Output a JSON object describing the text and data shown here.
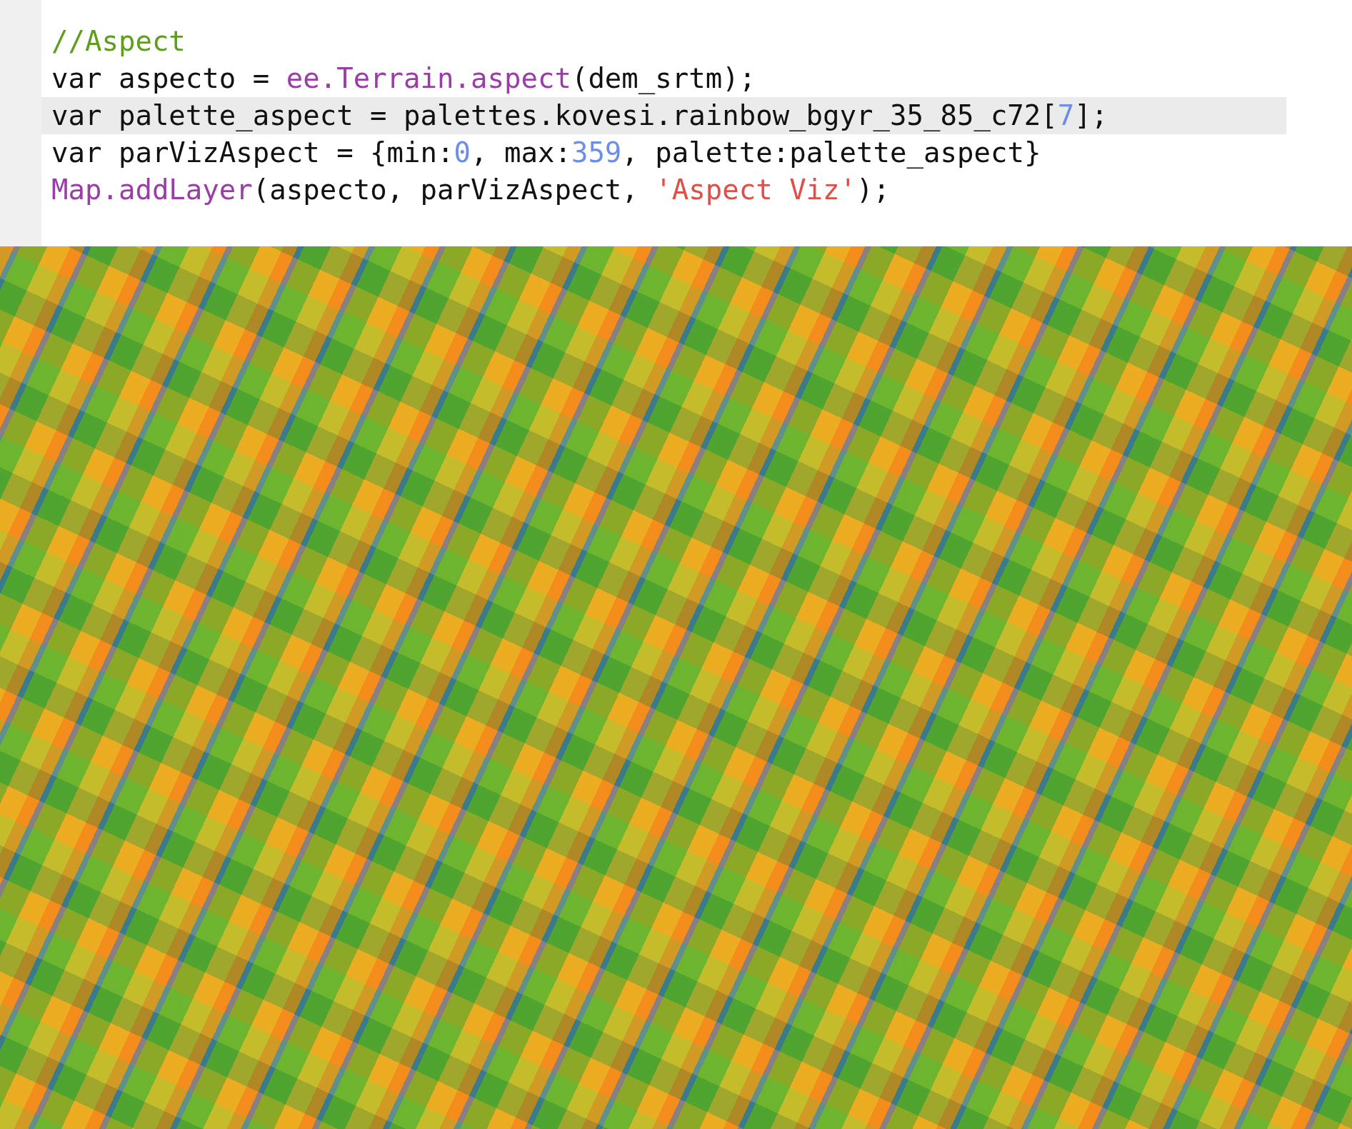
{
  "editor": {
    "lines": [
      {
        "selected": false,
        "tokens": [
          {
            "kind": "comment",
            "text": "//Aspect"
          }
        ]
      },
      {
        "selected": false,
        "tokens": [
          {
            "kind": "plain",
            "text": "var aspecto = "
          },
          {
            "kind": "builtin",
            "text": "ee.Terrain.aspect"
          },
          {
            "kind": "plain",
            "text": "(dem_srtm);"
          }
        ]
      },
      {
        "selected": true,
        "tokens": [
          {
            "kind": "plain",
            "text": "var palette_aspect = palettes.kovesi.rainbow_bgyr_35_85_c72["
          },
          {
            "kind": "number",
            "text": "7"
          },
          {
            "kind": "plain",
            "text": "];"
          }
        ]
      },
      {
        "selected": false,
        "tokens": [
          {
            "kind": "plain",
            "text": "var parVizAspect = {min:"
          },
          {
            "kind": "number",
            "text": "0"
          },
          {
            "kind": "plain",
            "text": ", max:"
          },
          {
            "kind": "number",
            "text": "359"
          },
          {
            "kind": "plain",
            "text": ", palette:palette_aspect}"
          }
        ]
      },
      {
        "selected": false,
        "tokens": [
          {
            "kind": "builtin",
            "text": "Map.addLayer"
          },
          {
            "kind": "plain",
            "text": "(aspecto, parVizAspect, "
          },
          {
            "kind": "string",
            "text": "'Aspect Viz'"
          },
          {
            "kind": "plain",
            "text": ");"
          }
        ]
      }
    ]
  }
}
